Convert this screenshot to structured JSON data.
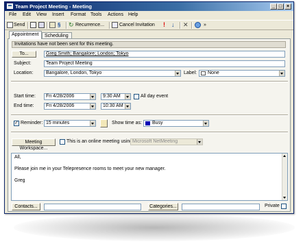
{
  "window": {
    "title": "Team Project Meeting - Meeting"
  },
  "menu": [
    "File",
    "Edit",
    "View",
    "Insert",
    "Format",
    "Tools",
    "Actions",
    "Help"
  ],
  "toolbar": {
    "send": "Send",
    "recurrence": "Recurrence...",
    "cancel_invitation": "Cancel Invitation"
  },
  "tabs": [
    "Appointment",
    "Scheduling"
  ],
  "info_bar": "Invitations have not been sent for this meeting.",
  "to": {
    "button": "To...",
    "value": "Greg Smith; Bangalore; London; Tokyo"
  },
  "subject": {
    "label": "Subject:",
    "value": "Team Project Meeting"
  },
  "location": {
    "label": "Location:",
    "value": "Bangalore, London, Tokyo"
  },
  "label_field": {
    "label": "Label:",
    "value": "None"
  },
  "start": {
    "label": "Start time:",
    "date": "Fri 4/28/2006",
    "time": "9:30 AM"
  },
  "end": {
    "label": "End time:",
    "date": "Fri 4/28/2006",
    "time": "10:30 AM"
  },
  "all_day": {
    "label": "All day event",
    "checked": false
  },
  "reminder": {
    "label": "Reminder:",
    "checked": true,
    "value": "15 minutes"
  },
  "show_time": {
    "label": "Show time as:",
    "value": "Busy",
    "color": "#0000b4"
  },
  "meeting_workspace": "Meeting Workspace...",
  "online": {
    "label": "This is an online meeting using:",
    "value": "Microsoft NetMeeting",
    "checked": false
  },
  "body_lines": [
    "All,",
    "Please join me in your Telepresence rooms to meet your new manager.",
    "Greg"
  ],
  "footer": {
    "contacts": "Contacts...",
    "categories": "Categories...",
    "private": "Private"
  }
}
